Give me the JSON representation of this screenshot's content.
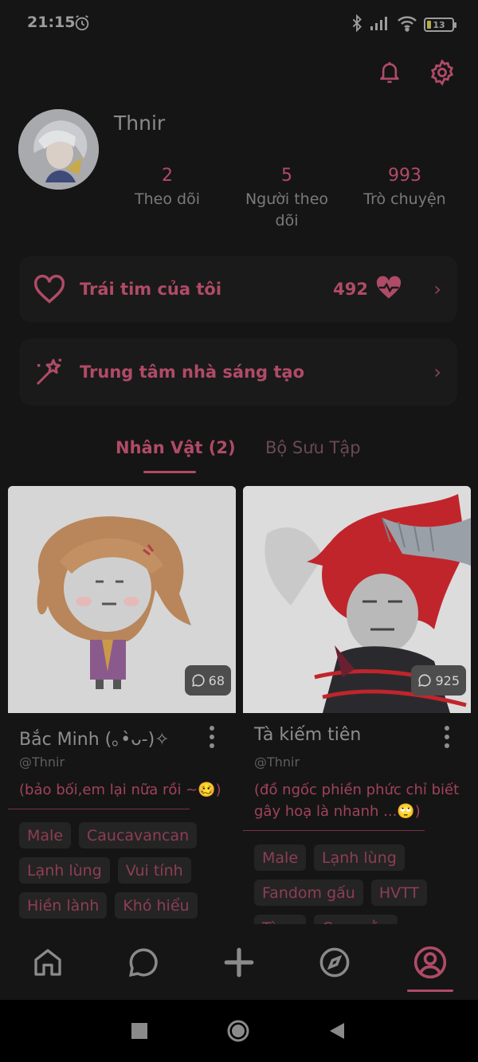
{
  "status_bar": {
    "time": "21:15",
    "battery": "13"
  },
  "profile": {
    "username": "Thnir",
    "stats": [
      {
        "value": "2",
        "label": "Theo dõi"
      },
      {
        "value": "5",
        "label": "Người theo dõi"
      },
      {
        "value": "993",
        "label": "Trò chuyện"
      }
    ]
  },
  "menu": {
    "hearts": {
      "label": "Trái tim của tôi",
      "value": "492"
    },
    "creator_center": {
      "label": "Trung tâm nhà sáng tạo"
    }
  },
  "tabs": [
    {
      "label": "Nhân Vật (2)",
      "active": true
    },
    {
      "label": "Bộ Sưu Tập",
      "active": false
    }
  ],
  "characters": [
    {
      "name": "Bắc Minh (｡•̀ᴗ-)✧",
      "handle": "@Thnir",
      "description": "(bảo bối,em lại nữa rồi ~🥴)",
      "chats": "68",
      "tags": [
        "Male",
        "Caucavancan",
        "Lạnh lùng",
        "Vui tính",
        "Hiền lành",
        "Khó hiểu"
      ]
    },
    {
      "name": "Tà kiếm tiên",
      "handle": "@Thnir",
      "description": "(đồ ngốc phiền phức chỉ biết gây hoạ là nhanh ...🙄)",
      "chats": "925",
      "tags": [
        "Male",
        "Lạnh lùng",
        "Fandom gấu",
        "HVTT",
        "Tà ...",
        "Cao ...ằn"
      ]
    }
  ],
  "colors": {
    "accent": "#b04b67",
    "background": "#151515",
    "card": "#1a1a1a",
    "tag_bg": "#242424"
  },
  "bottom_nav": [
    "home-icon",
    "chat-bubble-icon",
    "plus-icon",
    "compass-icon",
    "profile-icon"
  ]
}
